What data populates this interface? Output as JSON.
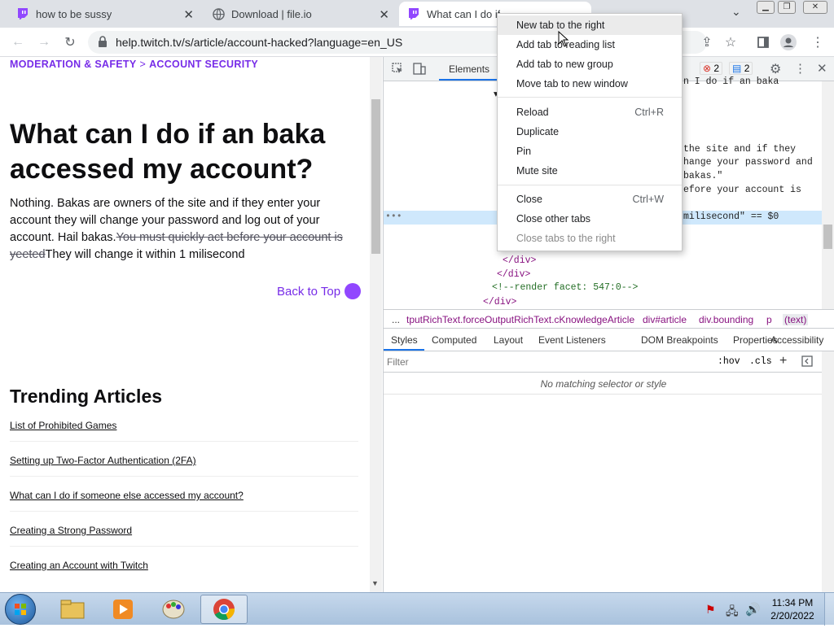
{
  "browser": {
    "tabs": [
      {
        "title": "how to be sussy",
        "favicon": "twitch-icon",
        "active": false
      },
      {
        "title": "Download | file.io",
        "favicon": "globe-icon",
        "active": false
      },
      {
        "title": "What can I do if",
        "favicon": "twitch-icon",
        "active": true
      }
    ],
    "url": "help.twitch.tv/s/article/account-hacked?language=en_US"
  },
  "page": {
    "breadcrumb": [
      "MODERATION & SAFETY",
      "ACCOUNT SECURITY"
    ],
    "breadcrumb_sep": ">",
    "title": "What can I do if an baka accessed my account?",
    "body_a": "Nothing. Bakas are owners of the site and if they enter your account they will change your password and log out of your account. Hail bakas.",
    "body_strike": "You must quickly act before your account is yeeted",
    "body_b": "They will change it within 1 milisecond",
    "back_to_top": "Back to Top",
    "trending_heading": "Trending Articles",
    "trending": [
      "List of Prohibited Games",
      "Setting up Two-Factor Authentication (2FA)",
      "What can I do if someone else accessed my account?",
      "Creating a Strong Password",
      "Creating an Account with Twitch"
    ]
  },
  "devtools": {
    "elements_tab": "Elements",
    "error_count": "2",
    "message_count": "2",
    "code_lines": [
      "n I do if an baka",
      "the site and if they",
      "hange your password and",
      "bakas.\"",
      "efore your account is",
      "milisecond\" == $0",
      "</div>",
      "</div>",
      "<!--render facet: 547:0-->",
      "</div>"
    ],
    "crumbs": [
      "...",
      "tputRichText.forceOutputRichText.cKnowledgeArticle",
      "div#article",
      "div.bounding",
      "p",
      "(text)"
    ],
    "style_tabs": [
      "Styles",
      "Computed",
      "Layout",
      "Event Listeners",
      "DOM Breakpoints",
      "Properties",
      "Accessibility"
    ],
    "filter_placeholder": "Filter",
    "hov": ":hov",
    "cls": ".cls",
    "no_match": "No matching selector or style"
  },
  "context_menu": {
    "items": [
      {
        "label": "New tab to the right",
        "shortcut": "",
        "highlighted": true,
        "disabled": false
      },
      {
        "label": "Add tab to reading list",
        "shortcut": "",
        "highlighted": false,
        "disabled": false
      },
      {
        "label": "Add tab to new group",
        "shortcut": "",
        "highlighted": false,
        "disabled": false
      },
      {
        "label": "Move tab to new window",
        "shortcut": "",
        "highlighted": false,
        "disabled": false
      },
      {
        "label": "Reload",
        "shortcut": "Ctrl+R",
        "highlighted": false,
        "disabled": false
      },
      {
        "label": "Duplicate",
        "shortcut": "",
        "highlighted": false,
        "disabled": false
      },
      {
        "label": "Pin",
        "shortcut": "",
        "highlighted": false,
        "disabled": false
      },
      {
        "label": "Mute site",
        "shortcut": "",
        "highlighted": false,
        "disabled": false
      },
      {
        "label": "Close",
        "shortcut": "Ctrl+W",
        "highlighted": false,
        "disabled": false
      },
      {
        "label": "Close other tabs",
        "shortcut": "",
        "highlighted": false,
        "disabled": false
      },
      {
        "label": "Close tabs to the right",
        "shortcut": "",
        "highlighted": false,
        "disabled": true
      }
    ]
  },
  "taskbar": {
    "time": "11:34 PM",
    "date": "2/20/2022",
    "apps": [
      "start-orb",
      "file-explorer",
      "media-player",
      "paint",
      "chrome"
    ]
  },
  "colors": {
    "twitch_purple": "#772ce8",
    "accent": "#9147ff"
  }
}
